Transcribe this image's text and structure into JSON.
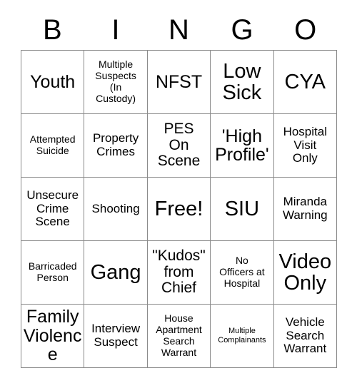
{
  "header": {
    "letters": [
      "B",
      "I",
      "N",
      "G",
      "O"
    ]
  },
  "grid": {
    "columns": 5,
    "rows": 5,
    "border_color": "#8a8a8a",
    "background_color": "#ffffff",
    "text_color": "#000000",
    "cells": [
      {
        "text": "Youth",
        "size": "xl"
      },
      {
        "text": "Multiple\nSuspects\n(In\nCustody)",
        "size": "sm"
      },
      {
        "text": "NFST",
        "size": "xl"
      },
      {
        "text": "Low\nSick",
        "size": "xxl"
      },
      {
        "text": "CYA",
        "size": "xxl"
      },
      {
        "text": "Attempted\nSuicide",
        "size": "sm"
      },
      {
        "text": "Property\nCrimes",
        "size": "md"
      },
      {
        "text": "PES\nOn\nScene",
        "size": "lg"
      },
      {
        "text": "'High\nProfile'",
        "size": "xl"
      },
      {
        "text": "Hospital\nVisit\nOnly",
        "size": "md"
      },
      {
        "text": "Unsecure\nCrime\nScene",
        "size": "md"
      },
      {
        "text": "Shooting",
        "size": "md"
      },
      {
        "text": "Free!",
        "size": "xxl"
      },
      {
        "text": "SIU",
        "size": "xxl"
      },
      {
        "text": "Miranda\nWarning",
        "size": "md"
      },
      {
        "text": "Barricaded\nPerson",
        "size": "sm"
      },
      {
        "text": "Gang",
        "size": "xxl"
      },
      {
        "text": "\"Kudos\"\nfrom\nChief",
        "size": "lg"
      },
      {
        "text": "No\nOfficers at\nHospital",
        "size": "sm"
      },
      {
        "text": "Video\nOnly",
        "size": "xxl"
      },
      {
        "text": "Family\nViolence",
        "size": "xl"
      },
      {
        "text": "Interview\nSuspect",
        "size": "md"
      },
      {
        "text": "House\nApartment\nSearch\nWarrant",
        "size": "sm"
      },
      {
        "text": "Multiple\nComplainants",
        "size": "xs"
      },
      {
        "text": "Vehicle\nSearch\nWarrant",
        "size": "md"
      }
    ]
  }
}
